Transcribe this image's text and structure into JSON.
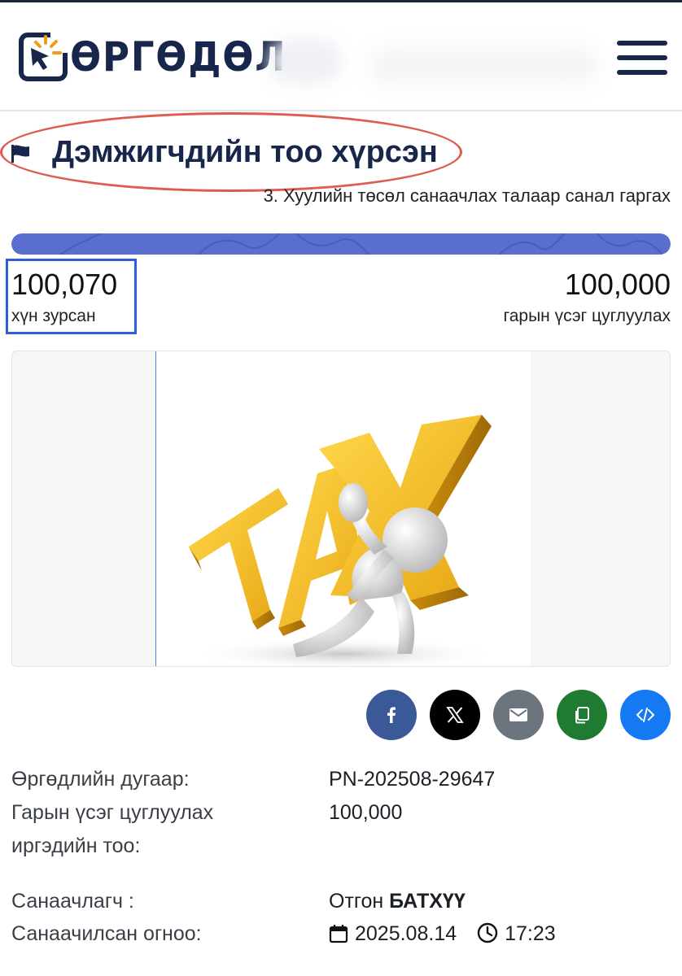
{
  "header": {
    "logo_text": "ӨРГӨДӨЛ",
    "menu_icon": "hamburger-icon"
  },
  "petition": {
    "status_icon": "flag-icon",
    "status_title": "Дэмжигчдийн тоо хүрсэн",
    "subtitle": "3. Хуулийн төсөл санаачлах талаар санал гаргах",
    "progress_fraction": 1.0,
    "signed_count": "100,070",
    "signed_label": "хүн зурсан",
    "goal_count": "100,000",
    "goal_label": "гарын үсэг цуглуулах",
    "image": "tax-burden-illustration",
    "image_text": "TAX"
  },
  "share": [
    {
      "name": "facebook",
      "icon": "facebook-icon",
      "color": "#3b5998"
    },
    {
      "name": "x",
      "icon": "x-icon",
      "color": "#000000"
    },
    {
      "name": "email",
      "icon": "envelope-icon",
      "color": "#6c757d"
    },
    {
      "name": "copy",
      "icon": "copy-icon",
      "color": "#1f7a32"
    },
    {
      "name": "embed",
      "icon": "code-icon",
      "color": "#1479f2"
    }
  ],
  "details": {
    "number_label": "Өргөдлийн дугаар:",
    "number_value": "PN-202508-29647",
    "target_label_line1": "Гарын үсэг цуглуулах",
    "target_label_line2": "иргэдийн тоо:",
    "target_value": "100,000",
    "initiator_label": "Санаачлагч :",
    "initiator_first": "Отгон",
    "initiator_last": "БАТХҮҮ",
    "date_label": "Санаачилсан огноо:",
    "date_value": "2025.08.14",
    "time_value": "17:23"
  },
  "colors": {
    "brand_navy": "#17264a",
    "progress": "#5a6ed0",
    "highlight_red": "#e05a50",
    "highlight_blue": "#2b5fd9",
    "logo_accent": "#f29a1c"
  }
}
